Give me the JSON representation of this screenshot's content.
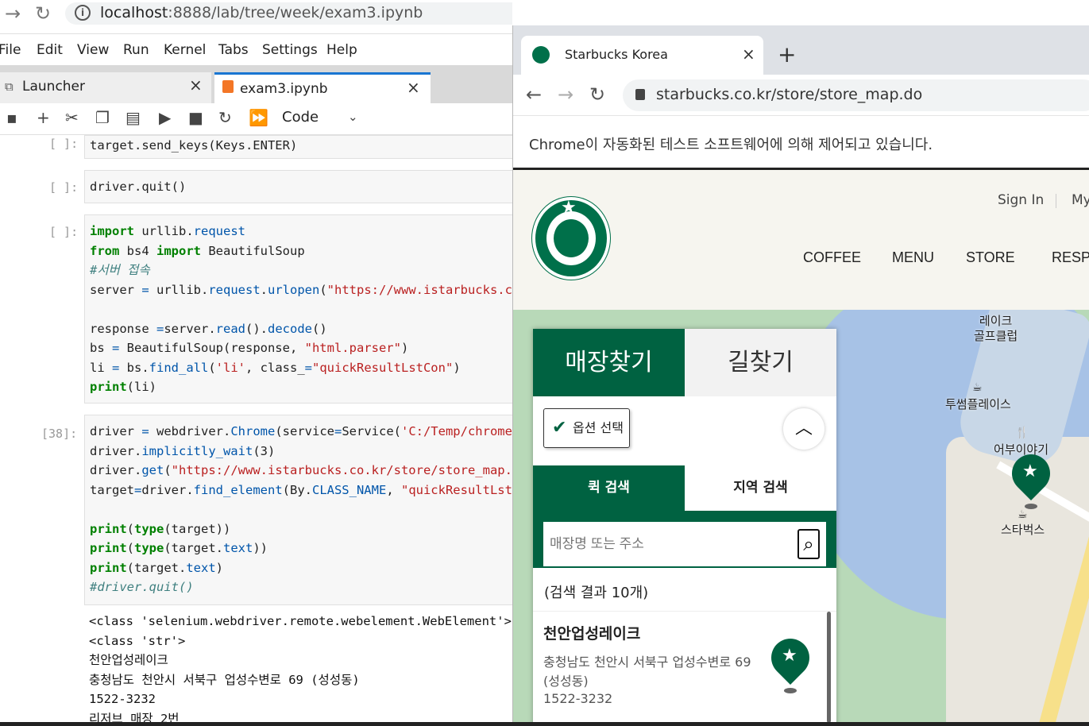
{
  "left_browser": {
    "url_host": "localhost",
    "url_rest": ":8888/lab/tree/week/exam3.ipynb"
  },
  "jupyter": {
    "menu": [
      "File",
      "Edit",
      "View",
      "Run",
      "Kernel",
      "Tabs",
      "Settings",
      "Help"
    ],
    "tabs": [
      {
        "label": "Launcher"
      },
      {
        "label": "exam3.ipynb"
      }
    ],
    "cell_type": "Code",
    "prompts": [
      "[ ]:",
      "[ ]:",
      "[ ]:",
      "[38]:"
    ],
    "cell1": "target.send_keys(Keys.ENTER)",
    "cell2": "driver.quit()",
    "output": [
      "<class 'selenium.webdriver.remote.webelement.WebElement'>",
      "<class 'str'>",
      "천안업성레이크",
      "충청남도 천안시 서북구 업성수변로 69 (성성동)",
      "1522-3232",
      "리저브 매장 2번"
    ]
  },
  "right_browser": {
    "tab_title": "Starbucks Korea",
    "url": "starbucks.co.kr/store/store_map.do",
    "infobar": "Chrome이 자동화된 테스트 소프트웨어에 의해 제어되고 있습니다."
  },
  "site": {
    "util": {
      "signin": "Sign In",
      "my": "My"
    },
    "nav": [
      "COFFEE",
      "MENU",
      "STORE",
      "RESP"
    ],
    "tabs": [
      "매장찾기",
      "길찾기"
    ],
    "option": "옵션 선택",
    "search_tabs": [
      "퀵 검색",
      "지역 검색"
    ],
    "search_placeholder": "매장명 또는 주소",
    "result_count": "(검색 결과 10개)",
    "store": {
      "name": "천안업성레이크",
      "address": "충청남도 천안시 서북구 업성수변로 69 (성성동)",
      "tel": "1522-3232"
    },
    "map_labels": {
      "golf": "레이크\n골프클럽",
      "twosome": "투썸플레이스",
      "fish": "어부이야기",
      "starbucks": "스타벅스"
    }
  },
  "colors": {
    "starbucks_green": "#006241",
    "jupyter_accent": "#1976d2"
  }
}
